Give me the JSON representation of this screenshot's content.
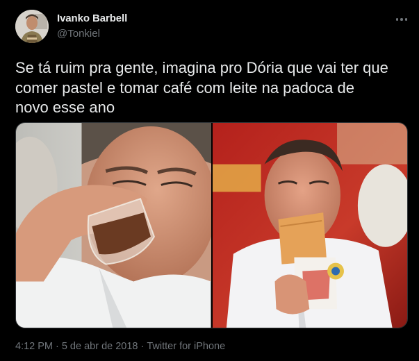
{
  "author": {
    "display_name": "Ivanko Barbell",
    "handle": "@Tonkiel",
    "avatar_icon": "user-avatar-photo"
  },
  "more_icon": "more-options-icon",
  "tweet": {
    "text_lines": [
      "Se tá ruim pra gente, imagina pro Dória que vai ter que",
      "comer pastel e tomar café com leite na padoca de",
      "novo esse ano"
    ]
  },
  "media": {
    "count": 2
  },
  "meta": {
    "time": "4:12 PM",
    "separator": "·",
    "date": "5 de abr de 2018",
    "source": "Twitter for iPhone"
  },
  "colors": {
    "background": "#000000",
    "text": "#e7e9ea",
    "secondary": "#71767b",
    "border": "#2f3336"
  }
}
